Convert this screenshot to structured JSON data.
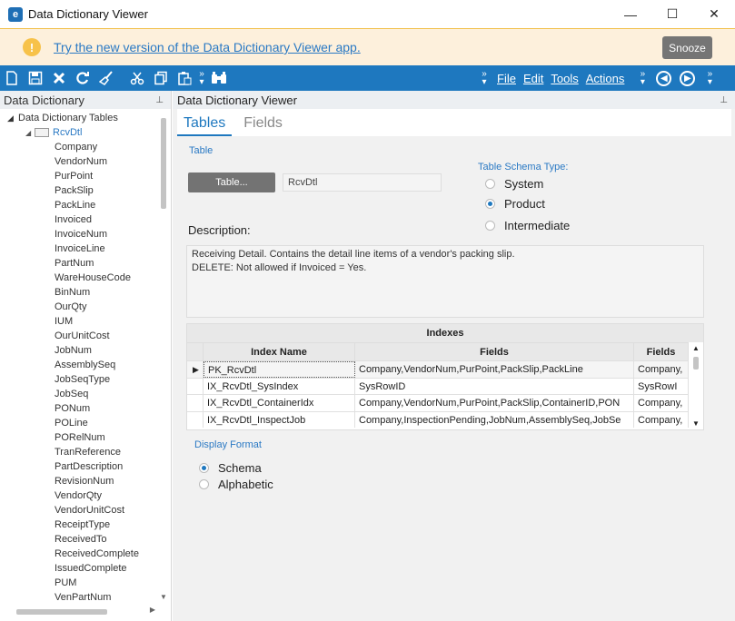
{
  "window": {
    "title": "Data Dictionary Viewer",
    "logo_letter": "e",
    "controls": {
      "minimize": "—",
      "maximize": "☐",
      "close": "✕"
    }
  },
  "banner": {
    "icon": "!",
    "link_text": "Try the new version of the Data Dictionary Viewer app.",
    "snooze_label": "Snooze"
  },
  "toolbar": {
    "icons": [
      "new-icon",
      "save-icon",
      "clear-icon",
      "refresh-icon",
      "broom-icon",
      "cut-icon",
      "copy-icon",
      "paste-icon",
      "binoculars-icon"
    ],
    "menus": [
      "File",
      "Edit",
      "Tools",
      "Actions"
    ]
  },
  "left_panel": {
    "header": "Data Dictionary",
    "root": "Data Dictionary Tables",
    "selected_table": "RcvDtl",
    "fields": [
      "Company",
      "VendorNum",
      "PurPoint",
      "PackSlip",
      "PackLine",
      "Invoiced",
      "InvoiceNum",
      "InvoiceLine",
      "PartNum",
      "WareHouseCode",
      "BinNum",
      "OurQty",
      "IUM",
      "OurUnitCost",
      "JobNum",
      "AssemblySeq",
      "JobSeqType",
      "JobSeq",
      "PONum",
      "POLine",
      "PORelNum",
      "TranReference",
      "PartDescription",
      "RevisionNum",
      "VendorQty",
      "VendorUnitCost",
      "ReceiptType",
      "ReceivedTo",
      "ReceivedComplete",
      "IssuedComplete",
      "PUM",
      "VenPartNum"
    ]
  },
  "right_panel": {
    "header": "Data Dictionary Viewer",
    "tabs": [
      "Tables",
      "Fields"
    ],
    "table_section_label": "Table",
    "table_button": "Table...",
    "table_value": "RcvDtl",
    "schema_type_label": "Table Schema Type:",
    "schema_types": [
      "System",
      "Product",
      "Intermediate"
    ],
    "schema_selected": "Product",
    "description_label": "Description:",
    "description_lines": [
      "Receiving Detail. Contains the detail line items of a vendor's packing slip.",
      "DELETE: Not allowed if Invoiced = Yes."
    ],
    "indexes": {
      "title": "Indexes",
      "columns": [
        "Index Name",
        "Fields",
        "Fields"
      ],
      "rows": [
        {
          "name": "PK_RcvDtl",
          "fields": "Company,VendorNum,PurPoint,PackSlip,PackLine",
          "fields2": "Company,"
        },
        {
          "name": "IX_RcvDtl_SysIndex",
          "fields": "SysRowID",
          "fields2": "SysRowI"
        },
        {
          "name": "IX_RcvDtl_ContainerIdx",
          "fields": "Company,VendorNum,PurPoint,PackSlip,ContainerID,PON",
          "fields2": "Company,"
        },
        {
          "name": "IX_RcvDtl_InspectJob",
          "fields": "Company,InspectionPending,JobNum,AssemblySeq,JobSe",
          "fields2": "Company,"
        }
      ]
    },
    "display_format_label": "Display Format",
    "display_formats": [
      "Schema",
      "Alphabetic"
    ],
    "display_selected": "Schema"
  }
}
